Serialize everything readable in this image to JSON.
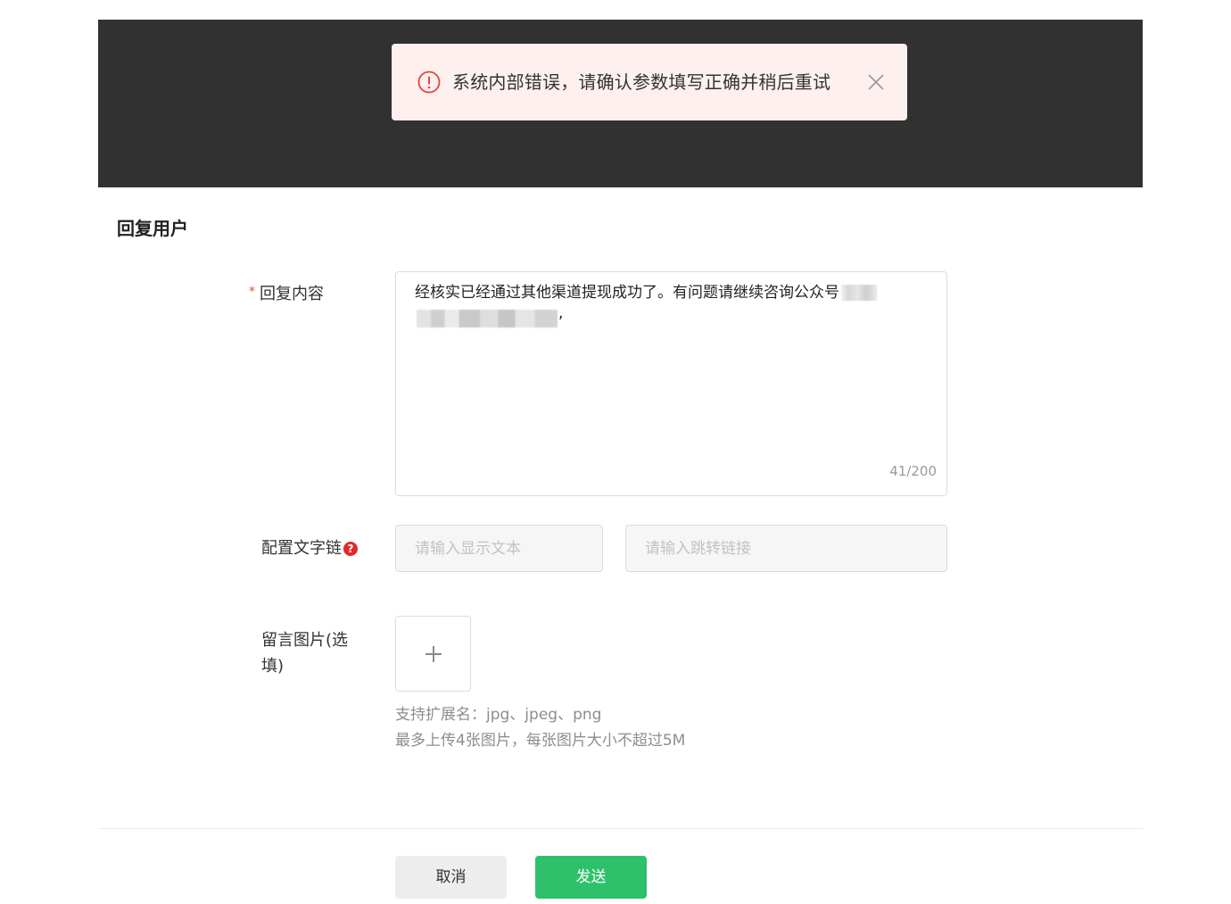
{
  "toast": {
    "message": "系统内部错误，请确认参数填写正确并稍后重试",
    "icon": "error-circle-icon",
    "close_icon": "close-icon",
    "background": "#fdf0ef",
    "icon_color": "#e8443a"
  },
  "form": {
    "title": "回复用户",
    "content": {
      "required_mark": "*",
      "label": "回复内容",
      "value_line1": "经核实已经通过其他渠道提现成功了。有问题请继续咨询公众号",
      "value_line2_suffix": ",",
      "counter": "41/200"
    },
    "text_link": {
      "label": "配置文字链",
      "help_icon": "?",
      "text_placeholder": "请输入显示文本",
      "url_placeholder": "请输入跳转链接"
    },
    "image": {
      "label": "留言图片(选填)",
      "upload_icon": "plus-icon",
      "hint_extensions": "支持扩展名：jpg、jpeg、png",
      "hint_limit": "最多上传4张图片，每张图片大小不超过5M"
    }
  },
  "actions": {
    "cancel_label": "取消",
    "send_label": "发送",
    "send_color": "#2fc06b"
  }
}
